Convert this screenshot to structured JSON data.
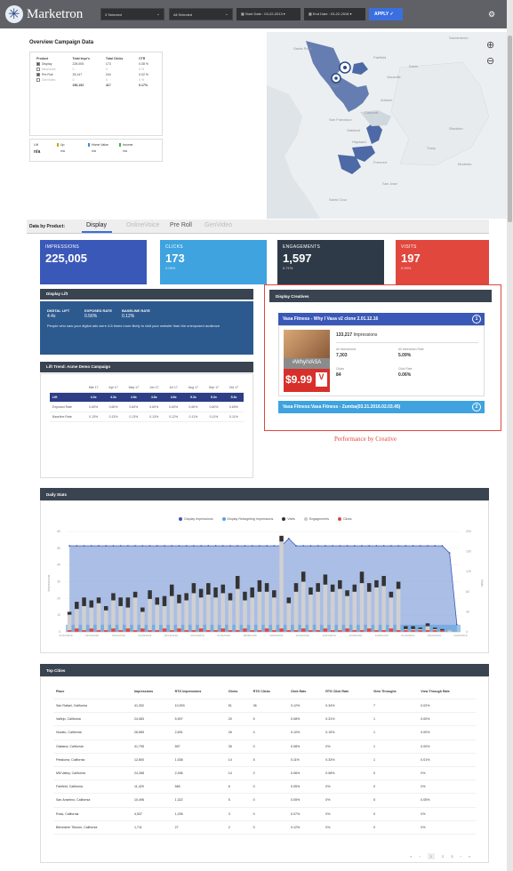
{
  "app": {
    "logo_text": "Marketron",
    "apply_label": "APPLY ✓"
  },
  "filters": [
    {
      "label": "3 Selected"
    },
    {
      "label": "All Selected"
    }
  ],
  "dates": {
    "start": "Start Date : 03-22-2013 ▾",
    "end": "End Date : 03-22-2018 ▾"
  },
  "overview": {
    "title": "Overview Campaign Data",
    "headers": [
      "Product",
      "Total Impr's",
      "Total Clicks",
      "CTR"
    ],
    "rows": [
      {
        "product": "Display",
        "impr": "225,005",
        "clicks": "173",
        "ctr": "0.08 %",
        "checked": true
      },
      {
        "product": "NewVoice",
        "impr": "0",
        "clicks": "0",
        "ctr": "0 %",
        "checked": false
      },
      {
        "product": "Pre Roll",
        "impr": "25,147",
        "clicks": "244",
        "ctr": "0.02 %",
        "checked": true
      },
      {
        "product": "GenVideo",
        "impr": "0",
        "clicks": "0",
        "ctr": "0 %",
        "checked": false
      }
    ],
    "total": {
      "impr": "250,152",
      "clicks": "417",
      "ctr": "0.17%"
    }
  },
  "lift_mini": {
    "label": "Lift",
    "value": "n/a",
    "cols": [
      {
        "name": "Up",
        "value": "n/a",
        "color": "#d4a017"
      },
      {
        "name": "Home Value",
        "value": "n/a",
        "color": "#3b8de0"
      },
      {
        "name": "Income",
        "value": "n/a",
        "color": "#45b045"
      }
    ]
  },
  "map_labels": [
    "Sacramento",
    "Santa Rosa",
    "Napa",
    "Fairfield",
    "Davis",
    "Vacaville",
    "Antioch",
    "Concord",
    "San Francisco",
    "Oakland",
    "Hayward",
    "Fremont",
    "San Jose",
    "Stockton",
    "Tracy",
    "Modesto",
    "Santa Cruz"
  ],
  "tabs": {
    "heading": "Data by Product:",
    "items": [
      "Display",
      "OnlineVoice",
      "Pre Roll",
      "GenVideo"
    ],
    "active": 0
  },
  "metrics": [
    {
      "label": "IMPRESSIONS",
      "value": "225,005",
      "sub": "",
      "color": "#3a58b8"
    },
    {
      "label": "CLICKS",
      "value": "173",
      "sub": "0.08%",
      "color": "#3ea3df"
    },
    {
      "label": "ENGAGEMENTS",
      "value": "1,597",
      "sub": "0.71%",
      "color": "#2e3a48"
    },
    {
      "label": "VISITS",
      "value": "197",
      "sub": "0.09%",
      "color": "#e1473d"
    }
  ],
  "display_lift": {
    "title": "Display Lift",
    "cols": [
      {
        "label": "DIGITAL LIFT",
        "value": "4.4x"
      },
      {
        "label": "EXPOSED RATE",
        "value": "0.56%"
      },
      {
        "label": "BASELINE RATE",
        "value": "0.12%"
      }
    ],
    "note": "People who saw your digital ads were 4.8 times more likely to visit your website than the unexposed audience"
  },
  "lift_trend": {
    "title": "Lift Trend: Acme Demo Campaign",
    "months": [
      "Mar 17",
      "Apr 17",
      "May 17",
      "Jun 17",
      "Jul 17",
      "Aug 17",
      "Sep 17",
      "Oct 17"
    ],
    "lift": [
      "4.3x",
      "4.3x",
      "4.8x",
      "4.8x",
      "4.8x",
      "5.3x",
      "5.3x",
      "5.3x"
    ],
    "exposed": [
      "0.60%",
      "0.60%",
      "0.60%",
      "0.60%",
      "0.60%",
      "0.60%",
      "0.60%",
      "0.60%"
    ],
    "baseline": [
      "0.13%",
      "0.13%",
      "0.13%",
      "0.13%",
      "0.12%",
      "0.11%",
      "0.11%",
      "0.11%"
    ],
    "row_labels": [
      "Lift",
      "Exposed Rate",
      "Baseline Rate"
    ]
  },
  "creatives": {
    "title": "Display Creatives",
    "items": [
      {
        "title": "Vasa Fitness - Why I Vasa v2 clone 2.01.12.16",
        "badge": "1"
      },
      {
        "title": "Vasa Fitness:Vasa Fitness - Zumba(03.21.2016.02.03.45)",
        "badge": "2"
      }
    ],
    "impressions": "133,217",
    "impressions_label": "Impressions",
    "stats": [
      {
        "label": "All Interactions",
        "value": "7,303"
      },
      {
        "label": "All Interaction Rate",
        "value": "5.09%"
      },
      {
        "label": "Clicks",
        "value": "84"
      },
      {
        "label": "Click Rate",
        "value": "0.06%"
      }
    ],
    "ad_hashtag": "#WhyIVASA",
    "ad_price": "$9.99",
    "caption": "Performance by Creative",
    "accent": "#e1473d"
  },
  "daily": {
    "title": "Daily Stats",
    "legend": [
      {
        "name": "Display Impressions",
        "color": "#3a58b8"
      },
      {
        "name": "Display Retargeting Impressions",
        "color": "#5aa0e0"
      },
      {
        "name": "Visits",
        "color": "#333"
      },
      {
        "name": "Engagements",
        "color": "#c8c8c8"
      },
      {
        "name": "Clicks",
        "color": "#e1473d"
      }
    ],
    "ylabel_left": "Impressions",
    "ylabel_right": "Visits"
  },
  "chart_data": {
    "type": "bar",
    "ylim_left": [
      0,
      300
    ],
    "ylim_right": [
      0,
      200
    ],
    "yticks_left": [
      "0",
      "10",
      "20",
      "30",
      "40",
      "50",
      "60"
    ],
    "yticks_right": [
      "0",
      "40",
      "80",
      "120",
      "160",
      "200"
    ],
    "x": [
      "01/22/2018",
      "02/14/2018",
      "03/22/2018",
      "04/18/2018",
      "05/16/2018",
      "06/13/2018",
      "07/11/2018",
      "08/08/2018",
      "09/05/2018",
      "10/03/2018",
      "10/31/2018",
      "11/28/2018",
      "12/26/2018",
      "01/23/2019",
      "02/20/2019",
      "03/20/2019"
    ],
    "series": [
      {
        "name": "Display Impressions",
        "values": [
          60,
          60,
          60,
          60,
          60,
          60,
          60,
          60,
          60,
          60,
          60,
          60,
          60,
          60,
          60,
          60,
          60,
          60,
          60,
          60,
          60,
          60,
          60,
          60,
          60,
          60,
          60,
          60,
          60,
          60,
          65,
          60,
          60,
          60,
          60,
          60,
          60,
          60,
          60,
          60,
          60,
          60,
          60,
          60,
          60,
          60,
          60,
          60,
          60,
          60,
          60,
          60,
          55,
          5
        ]
      },
      {
        "name": "Engagements",
        "values": [
          12,
          16,
          18,
          17,
          20,
          15,
          22,
          18,
          17,
          24,
          14,
          23,
          19,
          18,
          25,
          20,
          22,
          27,
          24,
          26,
          24,
          27,
          22,
          30,
          22,
          24,
          28,
          28,
          24,
          63,
          20,
          28,
          35,
          26,
          28,
          33,
          28,
          30,
          25,
          28,
          34,
          28,
          31,
          32,
          24,
          30,
          2,
          2,
          2,
          4,
          2,
          1,
          1,
          0
        ]
      },
      {
        "name": "Visits",
        "values": [
          2,
          5,
          6,
          5,
          4,
          3,
          5,
          6,
          7,
          4,
          3,
          6,
          5,
          7,
          8,
          6,
          5,
          7,
          6,
          8,
          7,
          6,
          5,
          9,
          6,
          7,
          8,
          6,
          5,
          4,
          4,
          6,
          7,
          5,
          6,
          7,
          5,
          6,
          4,
          5,
          8,
          6,
          5,
          7,
          4,
          5,
          2,
          2,
          1,
          2,
          1,
          1,
          0,
          0
        ]
      },
      {
        "name": "Clicks",
        "values": [
          1,
          2,
          1,
          2,
          1,
          1,
          2,
          1,
          2,
          1,
          2,
          1,
          1,
          2,
          1,
          2,
          1,
          1,
          2,
          1,
          1,
          2,
          1,
          1,
          2,
          1,
          1,
          2,
          1,
          2,
          1,
          1,
          2,
          1,
          1,
          2,
          1,
          1,
          2,
          1,
          1,
          2,
          1,
          1,
          2,
          1,
          1,
          1,
          1,
          1,
          1,
          1,
          0,
          0
        ]
      }
    ]
  },
  "top_cities": {
    "title": "Top Cities",
    "headers": [
      "Place",
      "Impressions",
      "RTG Impressions",
      "Clicks",
      "RTG Clicks",
      "Click Rate",
      "RTG Click Rate",
      "View Throughs",
      "View Through Rate"
    ],
    "rows": [
      [
        "San Rafael, California",
        "41,302",
        "10,593",
        "51",
        "36",
        "0.12%",
        "0.34%",
        "7",
        "0.02%"
      ],
      [
        "Vallejo, California",
        "24,083",
        "5,907",
        "20",
        "5",
        "0.08%",
        "0.31%",
        "1",
        "0.00%"
      ],
      [
        "Novato, California",
        "26,569",
        "2,691",
        "26",
        "4",
        "0.10%",
        "0.15%",
        "1",
        "0.00%"
      ],
      [
        "Oakland, California",
        "41,795",
        "557",
        "35",
        "0",
        "0.08%",
        "0%",
        "1",
        "0.00%"
      ],
      [
        "Petaluma, California",
        "12,800",
        "1,538",
        "14",
        "5",
        "0.11%",
        "0.33%",
        "1",
        "0.01%"
      ],
      [
        "Mill Valley, California",
        "24,268",
        "2,496",
        "14",
        "2",
        "0.06%",
        "0.08%",
        "0",
        "0%"
      ],
      [
        "Fairfield, California",
        "11,429",
        "565",
        "6",
        "0",
        "0.05%",
        "0%",
        "0",
        "0%"
      ],
      [
        "San Anselmo, California",
        "10,496",
        "1,322",
        "5",
        "0",
        "0.05%",
        "0%",
        "5",
        "0.05%"
      ],
      [
        "Ross, California",
        "4,537",
        "1,206",
        "3",
        "0",
        "0.07%",
        "0%",
        "0",
        "0%"
      ],
      [
        "Belvedere Tiburon, California",
        "1,711",
        "27",
        "2",
        "0",
        "0.12%",
        "0%",
        "0",
        "0%"
      ]
    ],
    "pager": [
      "«",
      "‹",
      "1",
      "2",
      "3",
      "›",
      "»"
    ]
  }
}
